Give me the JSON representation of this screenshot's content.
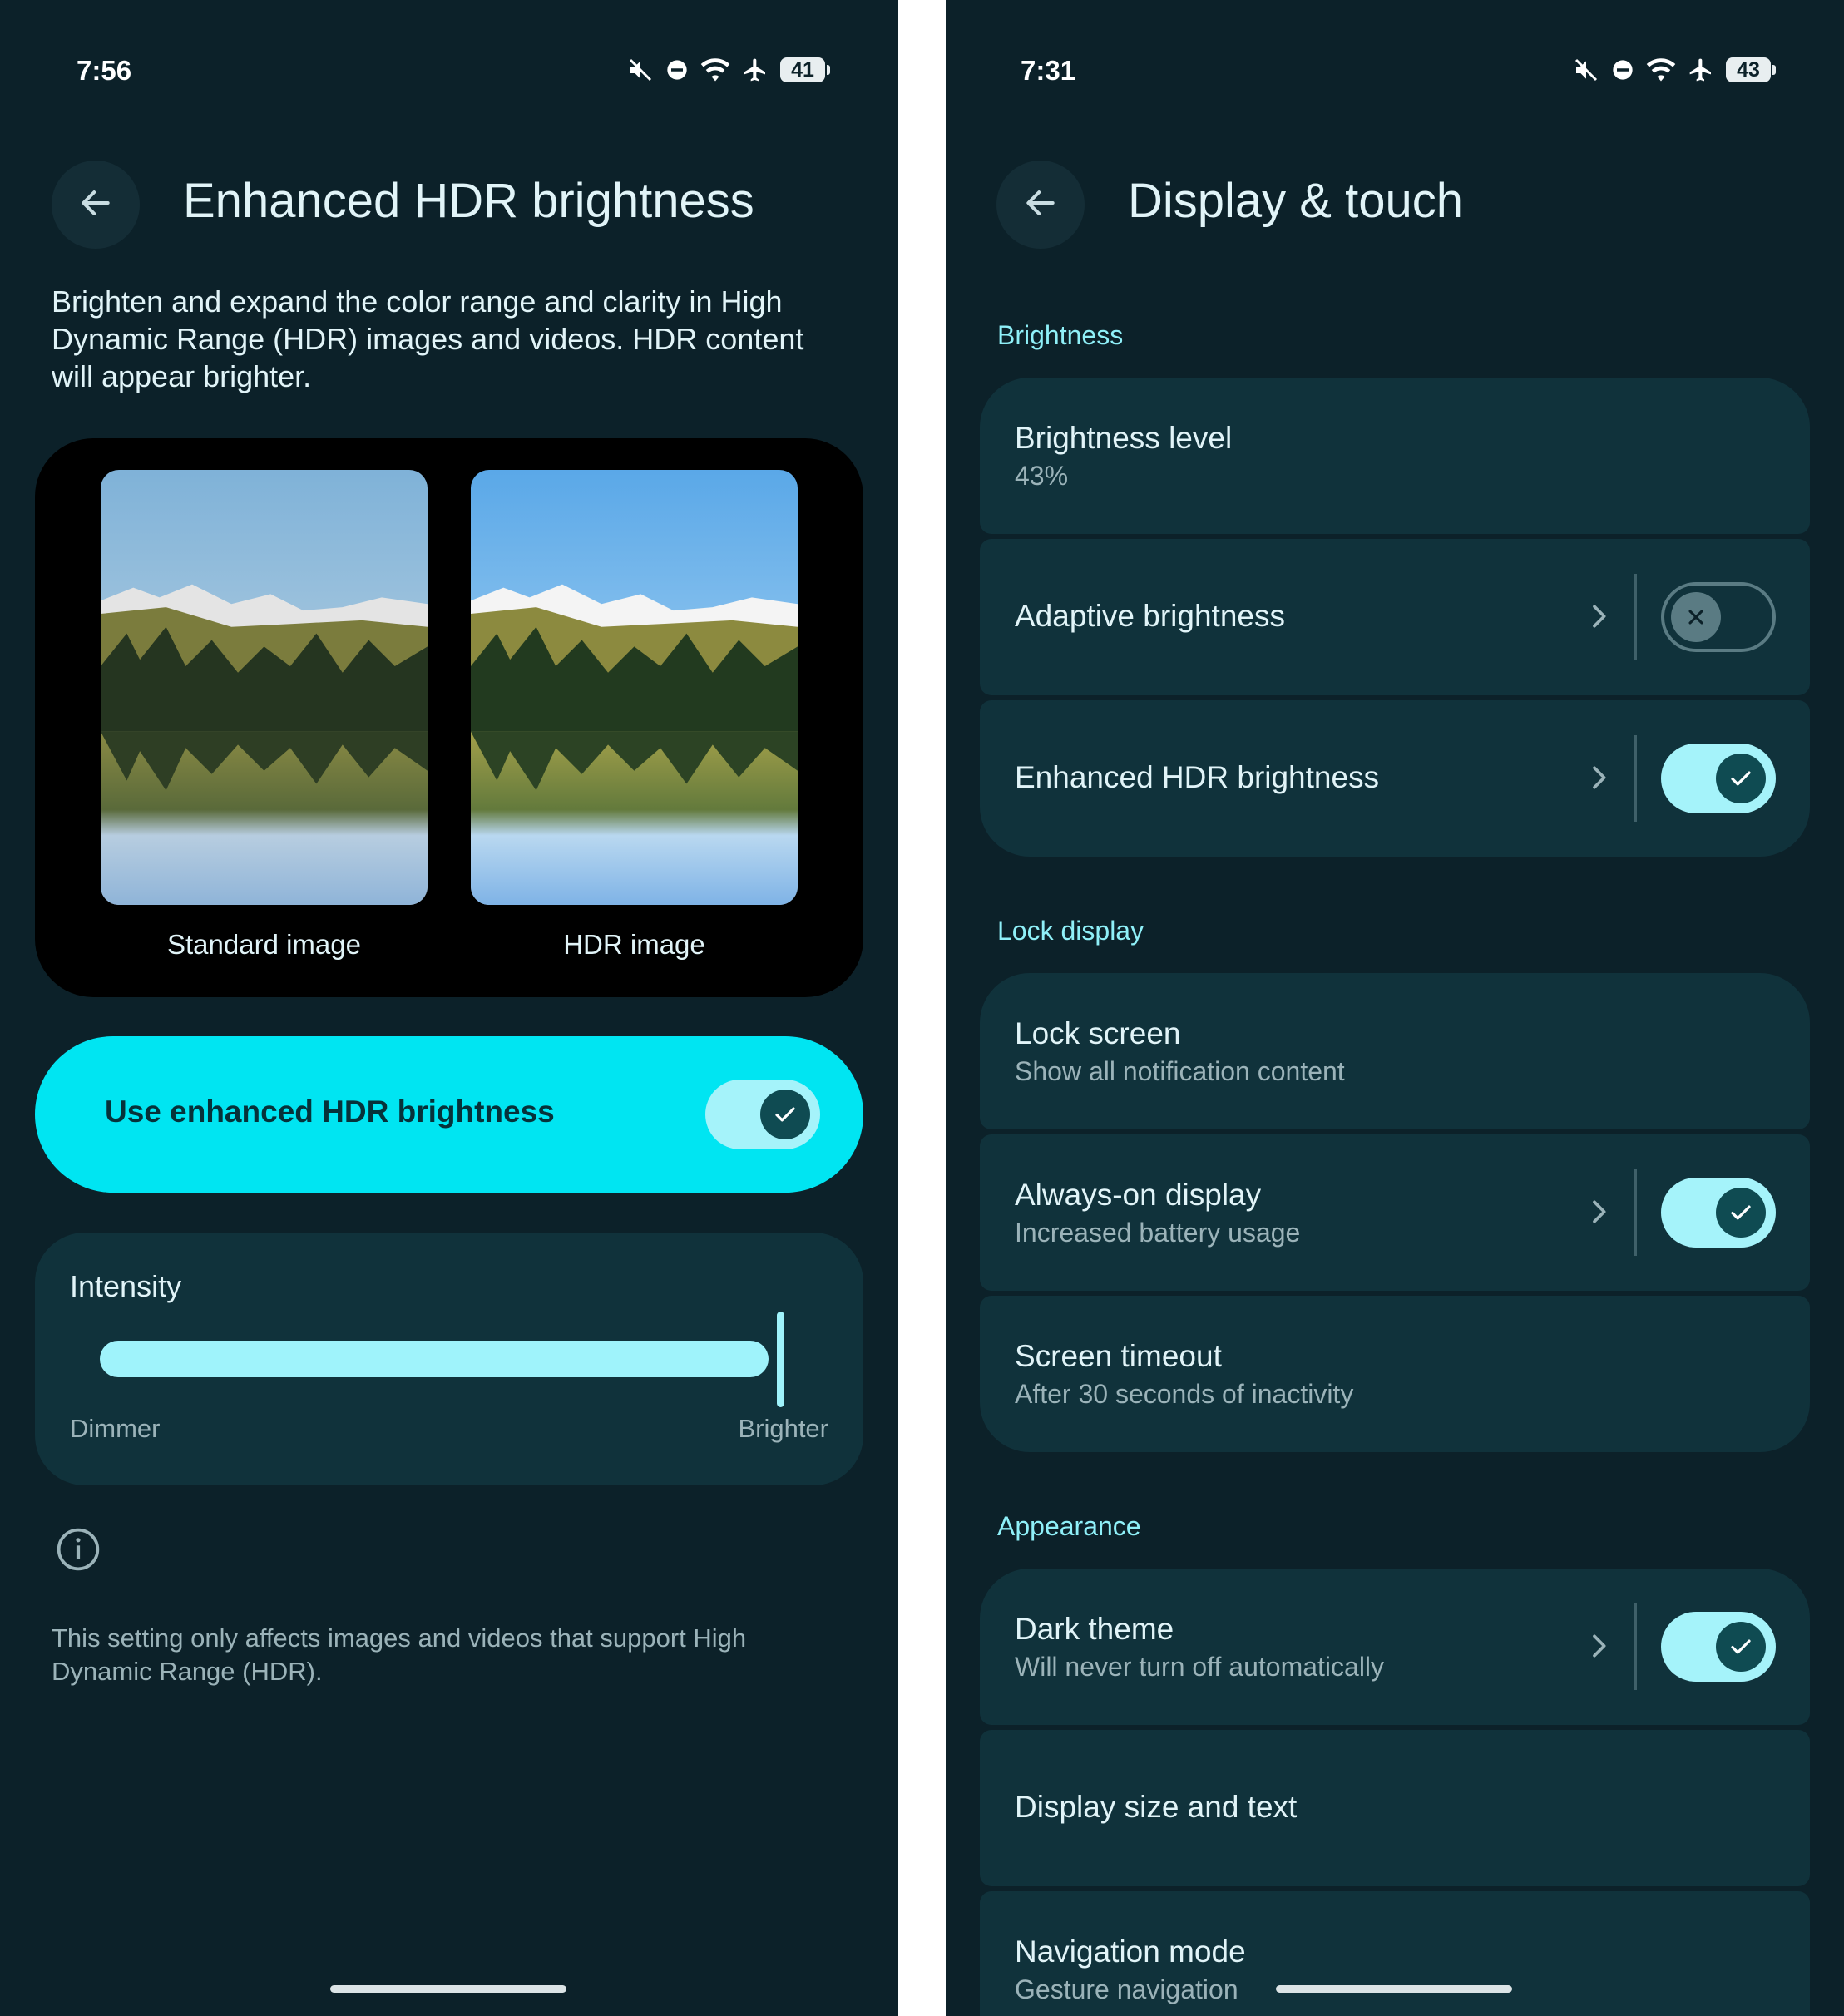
{
  "left": {
    "status": {
      "time": "7:56",
      "battery": "41"
    },
    "title": "Enhanced HDR brightness",
    "description": "Brighten and expand the color range and clarity in High Dynamic Range (HDR) images and videos. HDR content will appear brighter.",
    "comparison": {
      "standard_caption": "Standard image",
      "hdr_caption": "HDR image"
    },
    "toggle": {
      "label": "Use enhanced HDR brightness",
      "on": true
    },
    "intensity": {
      "title": "Intensity",
      "min_label": "Dimmer",
      "max_label": "Brighter",
      "value": 1.0
    },
    "footnote": "This setting only affects images and videos that support High Dynamic Range (HDR)."
  },
  "right": {
    "status": {
      "time": "7:31",
      "battery": "43"
    },
    "title": "Display & touch",
    "sections": {
      "brightness": "Brightness",
      "lock_display": "Lock display",
      "appearance": "Appearance"
    },
    "rows": {
      "brightness_level": {
        "title": "Brightness level",
        "subtitle": "43%"
      },
      "adaptive_brightness": {
        "title": "Adaptive brightness",
        "on": false
      },
      "enhanced_hdr": {
        "title": "Enhanced HDR brightness",
        "on": true
      },
      "lock_screen": {
        "title": "Lock screen",
        "subtitle": "Show all notification content"
      },
      "always_on": {
        "title": "Always-on display",
        "subtitle": "Increased battery usage",
        "on": true
      },
      "screen_timeout": {
        "title": "Screen timeout",
        "subtitle": "After 30 seconds of inactivity"
      },
      "dark_theme": {
        "title": "Dark theme",
        "subtitle": "Will never turn off automatically",
        "on": true
      },
      "display_size": {
        "title": "Display size and text"
      },
      "navigation_mode": {
        "title": "Navigation mode",
        "subtitle": "Gesture navigation"
      }
    }
  },
  "colors": {
    "background": "#0c2129",
    "card": "#10323b",
    "accent": "#00e5f2",
    "accent_light": "#a5f3fa",
    "section_header": "#8ff0f8"
  },
  "icons": {
    "back": "arrow-left-icon",
    "mute": "volume-off-icon",
    "dnd": "do-not-disturb-icon",
    "wifi": "wifi-icon",
    "airplane": "airplane-icon",
    "chevron": "chevron-right-icon",
    "check": "check-icon",
    "close": "close-icon",
    "info": "info-icon"
  }
}
